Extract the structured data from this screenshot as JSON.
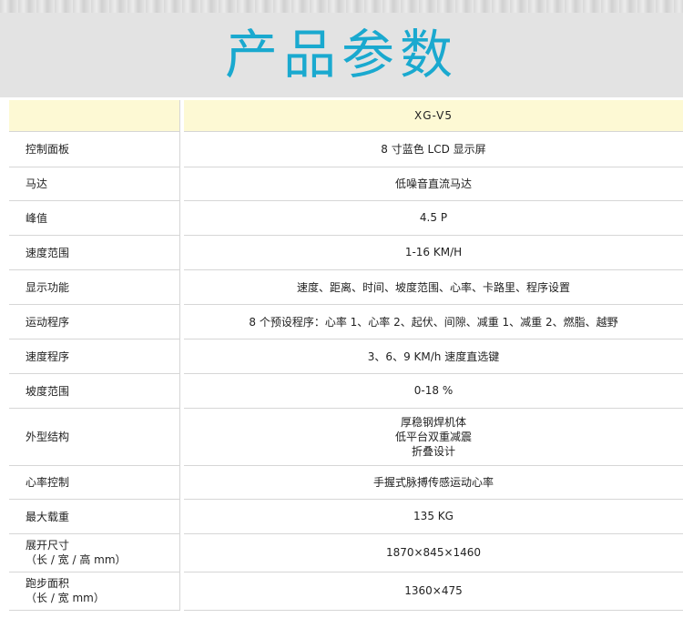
{
  "page": {
    "title": "产品参数"
  },
  "model": {
    "label": "",
    "value": "XG-V5"
  },
  "specs": [
    {
      "label": "控制面板",
      "value": "8 寸蓝色 LCD 显示屏"
    },
    {
      "label": "马达",
      "value": "低噪音直流马达"
    },
    {
      "label": "峰值",
      "value": "4.5 P"
    },
    {
      "label": "速度范围",
      "value": "1-16 KM/H"
    },
    {
      "label": "显示功能",
      "value": "速度、距离、时间、坡度范围、心率、卡路里、程序设置"
    },
    {
      "label": "运动程序",
      "value": "8 个预设程序：心率 1、心率 2、起伏、间隙、减重 1、减重 2、燃脂、越野"
    },
    {
      "label": "速度程序",
      "value": "3、6、9 KM/h 速度直选键"
    },
    {
      "label": "坡度范围",
      "value": "0-18 %"
    },
    {
      "label": "外型结构",
      "value_lines": [
        "厚稳钢焊机体",
        "低平台双重减震",
        "折叠设计"
      ]
    },
    {
      "label": "心率控制",
      "value": "手握式脉搏传感运动心率"
    },
    {
      "label": "最大载重",
      "value": "135 KG"
    },
    {
      "label_lines": [
        "展开尺寸",
        "（长 / 宽 / 高 mm）"
      ],
      "value": "1870×845×1460"
    },
    {
      "label_lines": [
        "跑步面积",
        "（长 / 宽 mm）"
      ],
      "value": "1360×475"
    }
  ]
}
